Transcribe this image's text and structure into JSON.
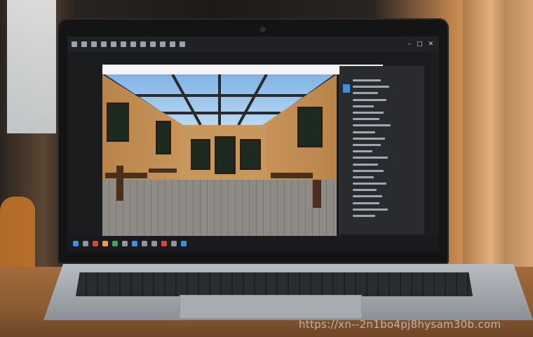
{
  "scene": {
    "description_icons": [
      "laptop-icon"
    ],
    "watermark_text": "https://xn--2n1bo4pj8hysam30b.com",
    "colors": {
      "screen_bg": "#1b1c1e",
      "taskbar_bg": "#1a1a1c",
      "side_panel_bg": "#2a2b2e",
      "accent": "#3d8fe0"
    }
  }
}
